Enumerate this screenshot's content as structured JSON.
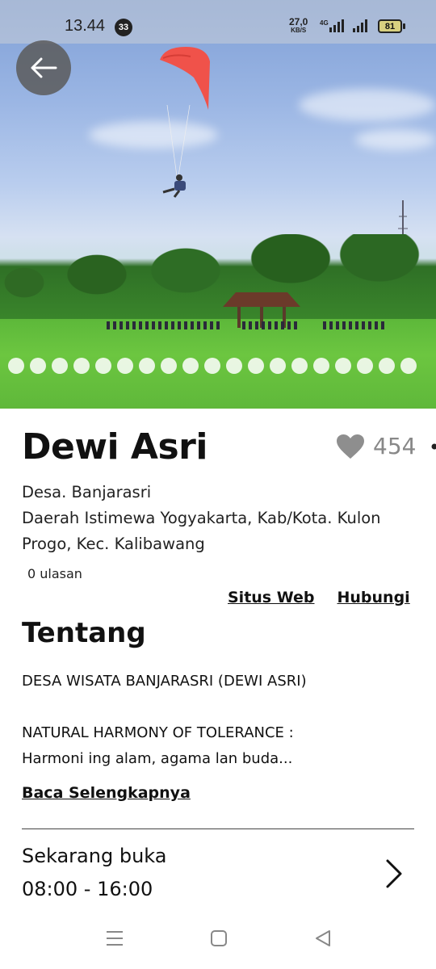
{
  "status_bar": {
    "time": "13.44",
    "notification_count": "33",
    "network_speed_value": "27,0",
    "network_speed_unit": "KB/S",
    "network_type": "4G",
    "battery": "81"
  },
  "hero": {
    "image_description_icon": "paragliding-photo",
    "slide_count": 19,
    "back_icon": "arrow-left-icon"
  },
  "place": {
    "name": "Dewi Asri",
    "like_count": "454",
    "village": "Desa. Banjarasri",
    "region": "Daerah Istimewa Yogyakarta, Kab/Kota. Kulon Progo, Kec. Kalibawang",
    "reviews": "0 ulasan"
  },
  "links": {
    "website": "Situs Web",
    "contact": "Hubungi"
  },
  "about": {
    "heading": "Tentang",
    "line1": "DESA WISATA BANJARASRI (DEWI ASRI)",
    "line2": "NATURAL HARMONY OF TOLERANCE :",
    "line3": "Harmoni ing alam, agama lan buda...",
    "read_more": "Baca Selengkapnya"
  },
  "hours": {
    "status": "Sekarang buka",
    "range": "08:00 - 16:00"
  },
  "colors": {
    "like_heart": "#8e8e8e",
    "wing": "#f0524a",
    "back_button_bg": "#5a5a5a"
  }
}
